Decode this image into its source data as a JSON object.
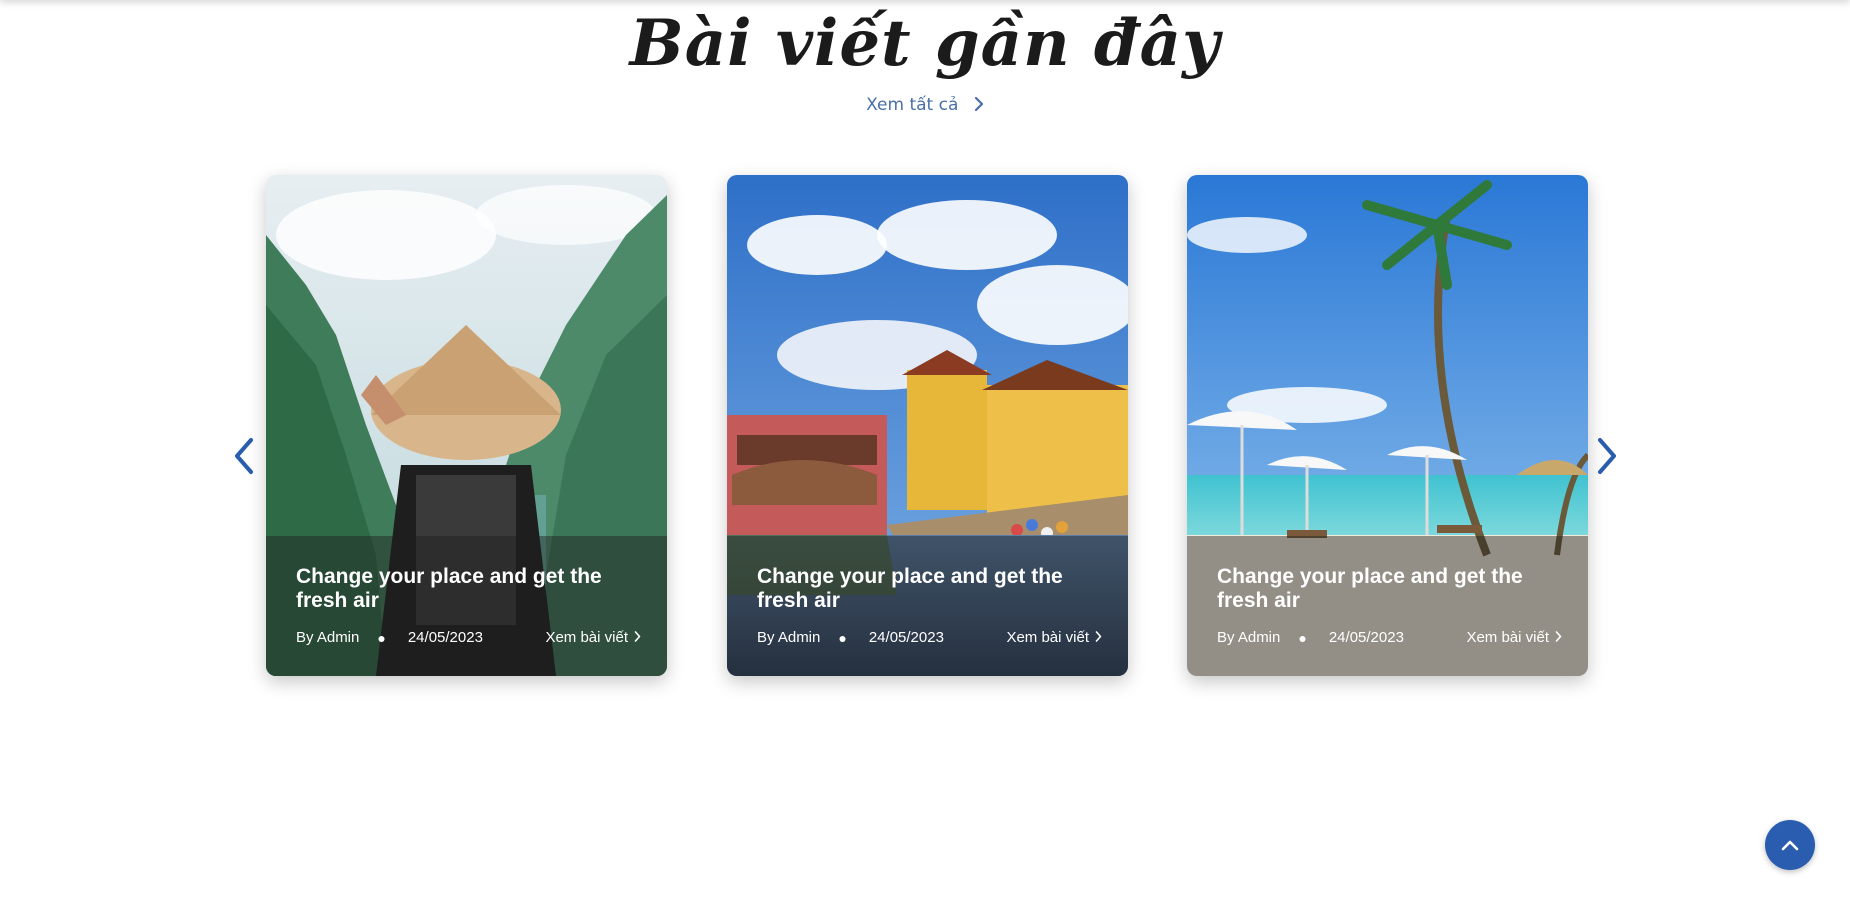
{
  "section": {
    "title": "Bài viết gần đây",
    "view_all_label": "Xem tất cả"
  },
  "colors": {
    "accent": "#2a5db0",
    "link": "#4a6fa8"
  },
  "posts": [
    {
      "title": "Change your place and get the fresh air",
      "author": "By Admin",
      "date": "24/05/2023",
      "read_label": "Xem bài viết",
      "image": "mountain-valley-conical-hat"
    },
    {
      "title": "Change your place and get the fresh air",
      "author": "By Admin",
      "date": "24/05/2023",
      "read_label": "Xem bài viết",
      "image": "hoi-an-bridge-river"
    },
    {
      "title": "Change your place and get the fresh air",
      "author": "By Admin",
      "date": "24/05/2023",
      "read_label": "Xem bài viết",
      "image": "tropical-beach-umbrellas"
    }
  ],
  "icons": {
    "prev": "chevron-left-icon",
    "next": "chevron-right-icon",
    "back_to_top": "chevron-up-icon"
  }
}
